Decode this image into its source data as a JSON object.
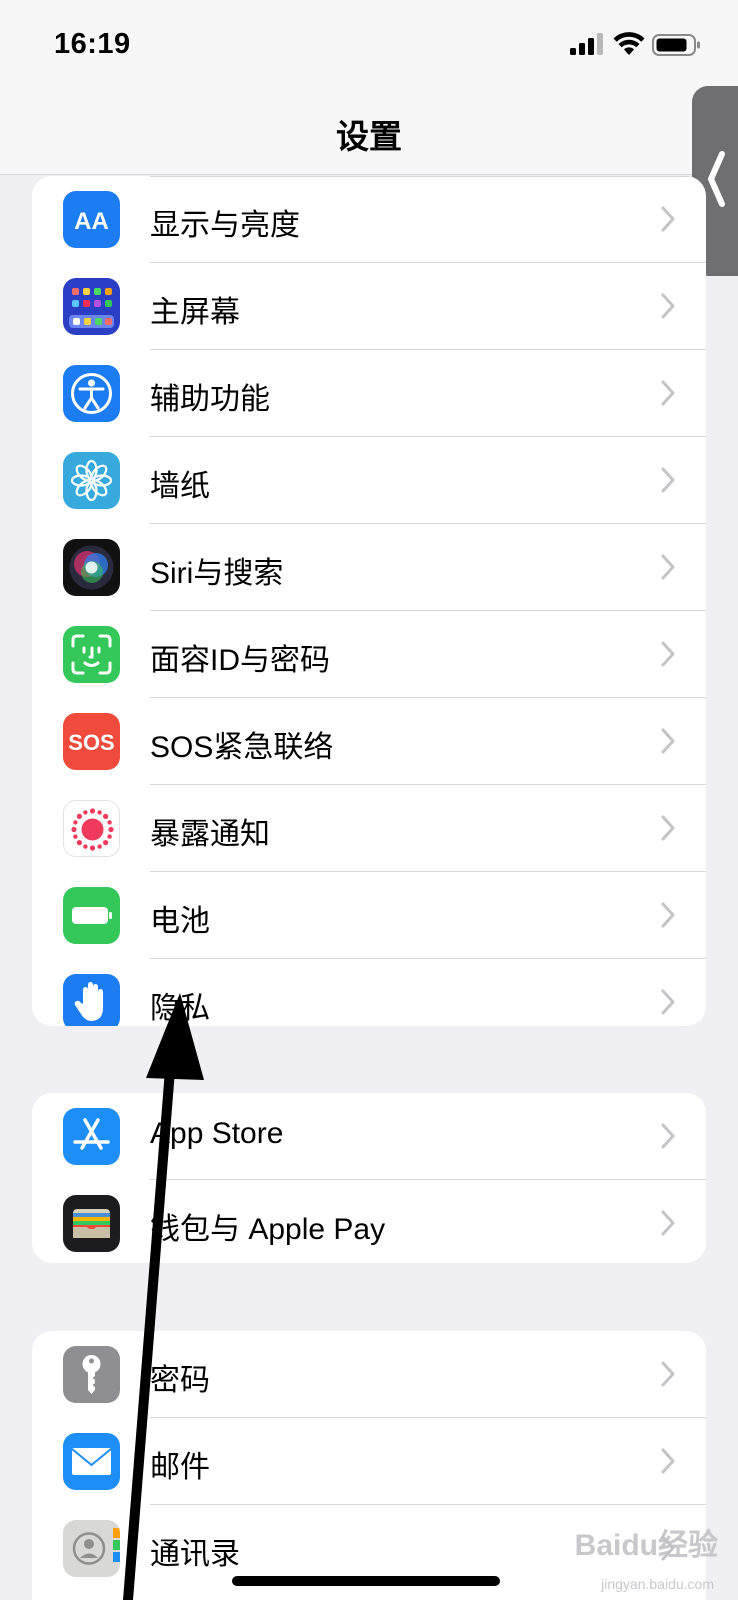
{
  "status_bar": {
    "time": "16:19"
  },
  "nav": {
    "title": "设置"
  },
  "groups": [
    {
      "items": [
        {
          "label": "显示与亮度",
          "icon": "display-brightness-icon",
          "color": "#1c7cf2"
        },
        {
          "label": "主屏幕",
          "icon": "home-screen-icon",
          "color": "#2a4bd0"
        },
        {
          "label": "辅助功能",
          "icon": "accessibility-icon",
          "color": "#1c7cf2"
        },
        {
          "label": "墙纸",
          "icon": "wallpaper-icon",
          "color": "#36aadd"
        },
        {
          "label": "Siri与搜索",
          "icon": "siri-icon",
          "color": "#1a1a2e"
        },
        {
          "label": "面容ID与密码",
          "icon": "face-id-icon",
          "color": "#34c759"
        },
        {
          "label": "SOS紧急联络",
          "icon": "sos-icon",
          "color": "#f04a3c"
        },
        {
          "label": "暴露通知",
          "icon": "exposure-notification-icon",
          "color": "#ffffff"
        },
        {
          "label": "电池",
          "icon": "battery-icon",
          "color": "#34c759"
        },
        {
          "label": "隐私",
          "icon": "privacy-hand-icon",
          "color": "#1c7cf2"
        }
      ]
    },
    {
      "items": [
        {
          "label": "App Store",
          "icon": "app-store-icon",
          "color": "#1c8ef5"
        },
        {
          "label": "钱包与 Apple Pay",
          "icon": "wallet-icon",
          "color": "#1c1c1e"
        }
      ]
    },
    {
      "items": [
        {
          "label": "密码",
          "icon": "key-icon",
          "color": "#8e8e93"
        },
        {
          "label": "邮件",
          "icon": "mail-icon",
          "color": "#1c8ef5"
        },
        {
          "label": "通讯录",
          "icon": "contacts-icon",
          "color": "#d8d8d4"
        }
      ]
    }
  ],
  "watermark": {
    "text": "Baidu经验",
    "sub": "jingyan.baidu.com"
  }
}
